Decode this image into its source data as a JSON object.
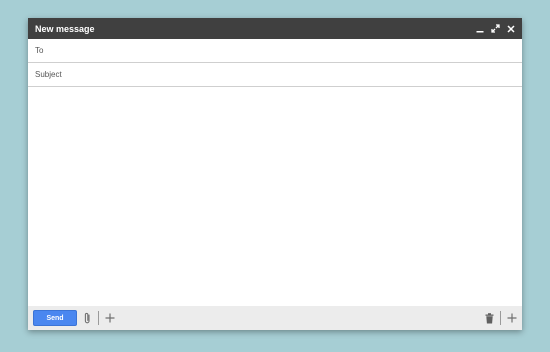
{
  "window": {
    "title": "New message"
  },
  "fields": {
    "to_label": "To",
    "subject_label": "Subject"
  },
  "footer": {
    "send_label": "Send"
  },
  "colors": {
    "background": "#a6ced4",
    "titlebar": "#404040",
    "send": "#4a87f0",
    "footer": "#ececec"
  },
  "icons": [
    "minimize-icon",
    "expand-icon",
    "close-icon",
    "paperclip-icon",
    "plus-icon",
    "trash-icon",
    "more-plus-icon"
  ]
}
